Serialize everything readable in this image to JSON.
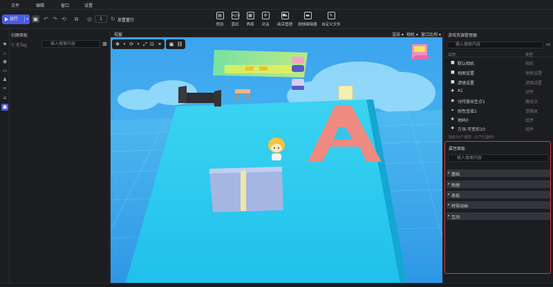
{
  "menubar": {
    "items": [
      "文件",
      "编辑",
      "窗口",
      "设置"
    ]
  },
  "toolbar": {
    "run_label": "运行",
    "counter_value": "1",
    "reset_label": "放置重行",
    "center_tools": [
      {
        "label": "预设",
        "icon": "preset-icon"
      },
      {
        "label": "蓝码",
        "icon": "code-icon"
      },
      {
        "label": "界面",
        "icon": "ui-icon"
      },
      {
        "label": "对话",
        "icon": "dialog-icon"
      },
      {
        "label": "商店管理",
        "icon": "shop-icon"
      },
      {
        "label": "剧情编辑器",
        "icon": "story-icon"
      },
      {
        "label": "自定义文件",
        "icon": "file-icon"
      }
    ]
  },
  "left_panel": {
    "title": "创建面板",
    "tag_filter": "无Tag",
    "search_placeholder": "输入搜索内容"
  },
  "viewport": {
    "title": "视窗",
    "dropdowns": [
      "渲染",
      "相机",
      "窗口比例"
    ]
  },
  "right_panel": {
    "title": "游戏资源管理器",
    "search_placeholder": "输入搜索内容",
    "col_name": "名称",
    "col_type": "类型",
    "items": [
      {
        "name": "默认相机",
        "type": "相机",
        "icon": "camera-icon"
      },
      {
        "name": "地图设置",
        "type": "地图设置",
        "icon": "map-settings-icon"
      },
      {
        "name": "滤镜设置",
        "type": "滤镜设置",
        "icon": "filter-icon"
      },
      {
        "name": "A1",
        "type": "组件",
        "icon": "component-icon"
      },
      {
        "name": "分阵营出生点1",
        "type": "路径点",
        "icon": "spawn-icon"
      },
      {
        "name": "刚性连接1",
        "type": "逻辑体",
        "icon": "joint-icon"
      },
      {
        "name": "地码0",
        "type": "组件",
        "icon": "component-icon"
      },
      {
        "name": "方块-可变形10",
        "type": "组件",
        "icon": "component-icon"
      }
    ],
    "status": "当前20个组件（1个已选中）"
  },
  "props_panel": {
    "title": "属性面板",
    "search_placeholder": "输入搜索内容",
    "sections": [
      "基础",
      "物理",
      "表现",
      "特殊动画",
      "互动"
    ]
  },
  "colors": {
    "accent": "#4a5ce0",
    "highlight_border": "#e5333d",
    "sky": "#3ea9f0",
    "floor": "#2bc8ea"
  }
}
